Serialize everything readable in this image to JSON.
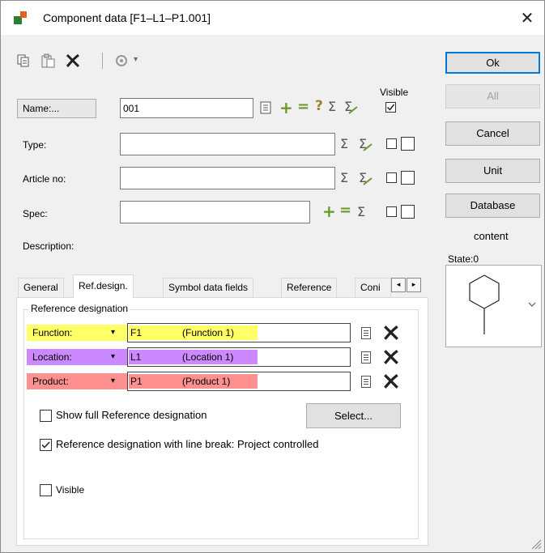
{
  "window": {
    "title": "Component data [F1–L1–P1.001]",
    "close_glyph": "✕"
  },
  "toolbar": {
    "copy_icon": "⎘",
    "paste_icon": "📋",
    "delete_icon": "✗",
    "more_icon": "▾"
  },
  "fields": {
    "name_button": "Name:...",
    "name_value": "001",
    "visible_header": "Visible",
    "type_label": "Type:",
    "type_value": "",
    "article_label": "Article no:",
    "article_value": "",
    "spec_label": "Spec:",
    "spec_value": "",
    "description_label": "Description:"
  },
  "symbols": {
    "sigma": "Σ",
    "sigma_arrow": "Σ",
    "plus": "+",
    "minus": "=",
    "question": "?"
  },
  "buttons": {
    "ok": "Ok",
    "all": "All",
    "cancel": "Cancel",
    "unit": "Unit",
    "database": "Database",
    "content": "content",
    "state": "State:0"
  },
  "tabs": [
    "General",
    "Ref.design.",
    "Symbol data fields",
    "Reference",
    "Coni"
  ],
  "tab_scroll": {
    "left": "◂",
    "right": "▸"
  },
  "refdesign": {
    "group_title": "Reference designation",
    "rows": [
      {
        "label": "Function:",
        "code": "F1",
        "name": "(Function 1)",
        "color": "#ffff66"
      },
      {
        "label": "Location:",
        "code": "L1",
        "name": "(Location 1)",
        "color": "#cc88ff"
      },
      {
        "label": "Product:",
        "code": "P1",
        "name": "(Product 1)",
        "color": "#ff9090"
      }
    ],
    "dropdown_glyph": "▾",
    "show_full_label": "Show full Reference designation",
    "show_full_checked": false,
    "select_button": "Select...",
    "line_break_label": "Reference designation with line break: Project controlled",
    "line_break_checked": true,
    "visible_label": "Visible",
    "visible_checked": false
  }
}
